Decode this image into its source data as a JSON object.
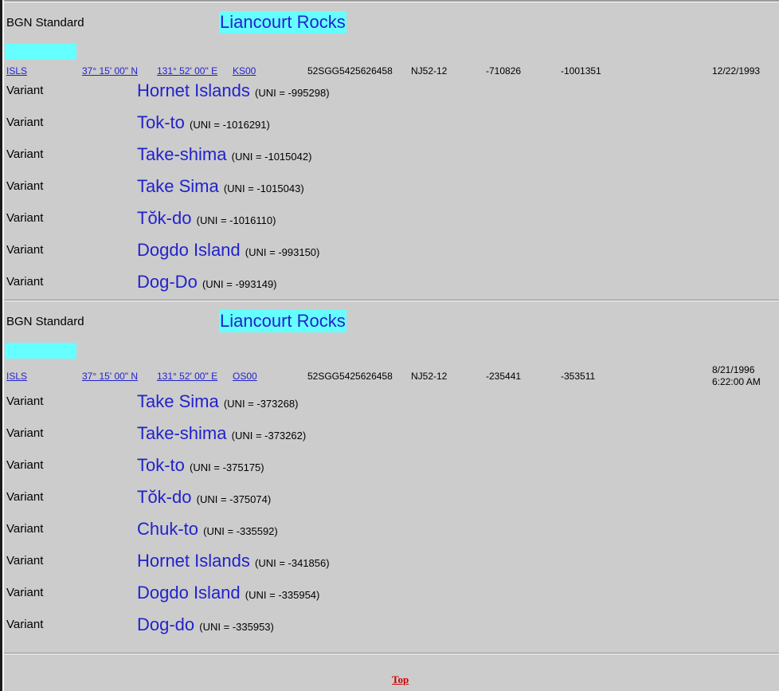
{
  "records": [
    {
      "standard_label": "BGN Standard",
      "name": "Liancourt Rocks",
      "info": {
        "feature_class": "ISLS",
        "latitude": "37° 15' 00\" N",
        "longitude": "131° 52' 00\" E",
        "country": "KS00",
        "mgrs": "52SGG5425626458",
        "jog": "NJ52-12",
        "ufi": "-710826",
        "uni": "-1001351",
        "date_line1": "12/22/1993",
        "date_line2": ""
      },
      "variants": [
        {
          "type": "Variant",
          "name": "Hornet Islands",
          "uni": "(UNI = -995298)"
        },
        {
          "type": "Variant",
          "name": "Tok-to",
          "uni": "(UNI = -1016291)"
        },
        {
          "type": "Variant",
          "name": "Take-shima",
          "uni": "(UNI = -1015042)"
        },
        {
          "type": "Variant",
          "name": "Take Sima",
          "uni": "(UNI = -1015043)"
        },
        {
          "type": "Variant",
          "name": "Tŏk-do",
          "uni": "(UNI = -1016110)"
        },
        {
          "type": "Variant",
          "name": "Dogdo Island",
          "uni": "(UNI = -993150)"
        },
        {
          "type": "Variant",
          "name": "Dog-Do",
          "uni": "(UNI = -993149)"
        }
      ]
    },
    {
      "standard_label": "BGN Standard",
      "name": "Liancourt Rocks",
      "info": {
        "feature_class": "ISLS",
        "latitude": "37° 15' 00\" N",
        "longitude": "131° 52' 00\" E",
        "country": "OS00",
        "mgrs": "52SGG5425626458",
        "jog": "NJ52-12",
        "ufi": "-235441",
        "uni": "-353511",
        "date_line1": "8/21/1996",
        "date_line2": "6:22:00 AM"
      },
      "variants": [
        {
          "type": "Variant",
          "name": "Take Sima",
          "uni": "(UNI = -373268)"
        },
        {
          "type": "Variant",
          "name": "Take-shima",
          "uni": "(UNI = -373262)"
        },
        {
          "type": "Variant",
          "name": "Tok-to",
          "uni": "(UNI = -375175)"
        },
        {
          "type": "Variant",
          "name": "Tŏk-do",
          "uni": "(UNI = -375074)"
        },
        {
          "type": "Variant",
          "name": "Chuk-to",
          "uni": "(UNI = -335592)"
        },
        {
          "type": "Variant",
          "name": "Hornet Islands",
          "uni": "(UNI = -341856)"
        },
        {
          "type": "Variant",
          "name": "Dogdo Island",
          "uni": "(UNI = -335954)"
        },
        {
          "type": "Variant",
          "name": "Dog-do",
          "uni": "(UNI = -335953)"
        }
      ]
    }
  ],
  "footer": {
    "top_link": "Top"
  },
  "colors": {
    "background": "#cccccc",
    "highlight": "#66ffff",
    "name_blue": "#2222cc",
    "link_red": "#cc0000"
  }
}
